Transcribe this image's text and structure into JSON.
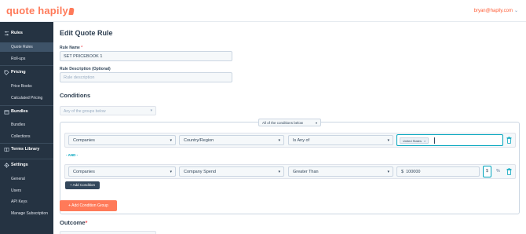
{
  "app": {
    "logo_text": "quote hapily",
    "user_email": "bryan@hapily.com"
  },
  "colors": {
    "brand": "#ff7a59",
    "sidebar": "#253342",
    "accent": "#00a4bd",
    "dark_button": "#33475b"
  },
  "sidebar": {
    "sections": [
      {
        "label": "Rules",
        "icon": "sliders-icon",
        "items": [
          {
            "label": "Quote Rules",
            "active": true
          },
          {
            "label": "Roll-ups",
            "active": false
          }
        ]
      },
      {
        "label": "Pricing",
        "icon": "tag-icon",
        "items": [
          {
            "label": "Price Books",
            "active": false
          },
          {
            "label": "Calculated Pricing",
            "active": false
          }
        ]
      },
      {
        "label": "Bundles",
        "icon": "box-icon",
        "items": [
          {
            "label": "Bundles",
            "active": false
          },
          {
            "label": "Collections",
            "active": false
          }
        ]
      },
      {
        "label": "Terms Library",
        "icon": "book-icon",
        "items": []
      },
      {
        "label": "Settings",
        "icon": "gear-icon",
        "items": [
          {
            "label": "General",
            "active": false
          },
          {
            "label": "Users",
            "active": false
          },
          {
            "label": "API Keys",
            "active": false
          },
          {
            "label": "Manage Subscription",
            "active": false
          }
        ]
      }
    ]
  },
  "form": {
    "title": "Edit Quote Rule",
    "rule_name_label": "Rule Name",
    "required_mark": "*",
    "rule_name_value": "SET PRICEBOOK 1",
    "rule_description_label": "Rule Description (Optional)",
    "rule_description_placeholder": "Rule description"
  },
  "conditions": {
    "title": "Conditions",
    "group_select_placeholder": "Any of the groups below",
    "match_select_value": "All of the conditions below",
    "and_label": "- AND -",
    "add_condition_label": "+ Add Condition",
    "rows": [
      {
        "object": "Companies",
        "property": "Country/Region",
        "operator": "Is Any of",
        "tags": [
          "United States"
        ]
      },
      {
        "object": "Companies",
        "property": "Company Spend",
        "operator": "Greater Than",
        "currency": "$",
        "amount": "100000",
        "unit_dollar": "$",
        "unit_percent": "%"
      }
    ],
    "add_group_label": "+ Add Condition Group"
  },
  "outcome": {
    "title": "Outcome"
  }
}
